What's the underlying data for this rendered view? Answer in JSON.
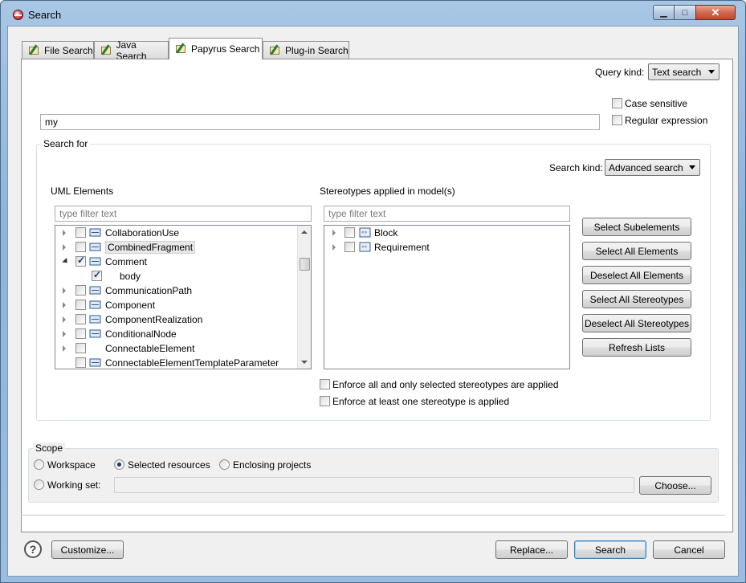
{
  "window": {
    "title": "Search",
    "controls": {
      "minimize": "▁",
      "maximize": "□",
      "close": "✕"
    }
  },
  "tabs": [
    {
      "label": "File Search",
      "active": false,
      "icon": "file-search-icon"
    },
    {
      "label": "Java Search",
      "active": false,
      "icon": "java-search-icon"
    },
    {
      "label": "Papyrus Search",
      "active": true,
      "icon": "papyrus-search-icon"
    },
    {
      "label": "Plug-in Search",
      "active": false,
      "icon": "plugin-search-icon"
    }
  ],
  "query": {
    "kind_label": "Query kind:",
    "kind_value": "Text search",
    "text_value": "my",
    "case_sensitive_label": "Case sensitive",
    "case_sensitive": false,
    "regex_label": "Regular expression",
    "regex": false
  },
  "search_for": {
    "group_title": "Search for",
    "kind_label": "Search kind:",
    "kind_value": "Advanced search",
    "uml": {
      "title": "UML Elements",
      "filter_placeholder": "type filter text",
      "items": [
        {
          "label": "CollaborationUse",
          "expander": "collapsed",
          "checked": false,
          "icon": "collaboration-use-icon",
          "level": 0
        },
        {
          "label": "CombinedFragment",
          "expander": "collapsed",
          "checked": false,
          "icon": "combined-fragment-icon",
          "level": 0,
          "highlight": true
        },
        {
          "label": "Comment",
          "expander": "expanded",
          "checked": true,
          "icon": "comment-icon",
          "level": 0
        },
        {
          "label": "body",
          "expander": "none",
          "checked": true,
          "icon": "",
          "level": 1
        },
        {
          "label": "CommunicationPath",
          "expander": "collapsed",
          "checked": false,
          "icon": "communication-path-icon",
          "level": 0
        },
        {
          "label": "Component",
          "expander": "collapsed",
          "checked": false,
          "icon": "component-icon",
          "level": 0
        },
        {
          "label": "ComponentRealization",
          "expander": "collapsed",
          "checked": false,
          "icon": "component-realization-icon",
          "level": 0
        },
        {
          "label": "ConditionalNode",
          "expander": "collapsed",
          "checked": false,
          "icon": "conditional-node-icon",
          "level": 0
        },
        {
          "label": "ConnectableElement",
          "expander": "collapsed",
          "checked": false,
          "icon": "",
          "level": 0
        },
        {
          "label": "ConnectableElementTemplateParameter",
          "expander": "none",
          "checked": false,
          "icon": "template-parameter-icon",
          "level": 0
        }
      ]
    },
    "stereo": {
      "title": "Stereotypes applied in model(s)",
      "filter_placeholder": "type filter text",
      "items": [
        {
          "label": "Block",
          "checked": false,
          "icon": "block-stereotype-icon"
        },
        {
          "label": "Requirement",
          "checked": false,
          "icon": "requirement-stereotype-icon"
        }
      ]
    },
    "buttons": {
      "select_sub": "Select Subelements",
      "select_all_el": "Select All Elements",
      "deselect_all_el": "Deselect All Elements",
      "select_all_st": "Select All Stereotypes",
      "deselect_all_st": "Deselect All Stereotypes",
      "refresh": "Refresh Lists"
    },
    "enforce_all_label": "Enforce all and only selected stereotypes are applied",
    "enforce_all": false,
    "enforce_one_label": "Enforce at least one stereotype is applied",
    "enforce_one": false
  },
  "scope": {
    "group_title": "Scope",
    "workspace_label": "Workspace",
    "selected_resources_label": "Selected resources",
    "enclosing_projects_label": "Enclosing projects",
    "working_set_label": "Working set:",
    "working_set_value": "",
    "choose_label": "Choose...",
    "selected": "selected_resources"
  },
  "footer": {
    "help": "?",
    "customize": "Customize...",
    "replace": "Replace...",
    "search": "Search",
    "cancel": "Cancel"
  }
}
